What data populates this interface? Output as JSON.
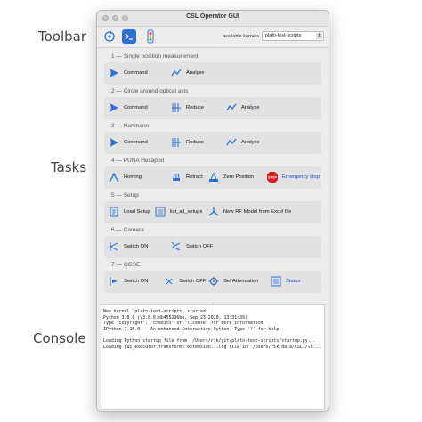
{
  "side_labels": {
    "toolbar": "Toolbar",
    "tasks": "Tasks",
    "console": "Console"
  },
  "window": {
    "title": "CSL Operator GUI"
  },
  "toolbar": {
    "kernel_label": "available kernels",
    "kernel_value": "plato-test-scripts"
  },
  "groups": [
    {
      "title": "1 — Single position measurement",
      "tasks": [
        {
          "label": "Command",
          "icon": "send-icon"
        },
        {
          "label": "Analyse",
          "icon": "analyse-icon"
        }
      ]
    },
    {
      "title": "2 — Circle around optical axis",
      "tasks": [
        {
          "label": "Command",
          "icon": "send-icon"
        },
        {
          "label": "Reduce",
          "icon": "reduce-icon"
        },
        {
          "label": "Analyse",
          "icon": "analyse-icon"
        }
      ]
    },
    {
      "title": "3 — Hartmann",
      "tasks": [
        {
          "label": "Command",
          "icon": "send-icon"
        },
        {
          "label": "Reduce",
          "icon": "reduce-icon"
        },
        {
          "label": "Analyse",
          "icon": "analyse-icon"
        }
      ]
    },
    {
      "title": "4 — PUNA Hexapod",
      "tasks": [
        {
          "label": "Homing",
          "icon": "homing-icon"
        },
        {
          "label": "Retract",
          "icon": "retract-icon"
        },
        {
          "label": "Zero Position",
          "icon": "zero-position-icon"
        },
        {
          "label": "Emergency stop",
          "icon": "stop-icon",
          "stop_text": "STOP"
        }
      ]
    },
    {
      "title": "5 — Setup",
      "tasks": [
        {
          "label": "Load Setup",
          "icon": "load-setup-icon"
        },
        {
          "label": "list_all_setups",
          "icon": "list-icon"
        },
        {
          "label": "New RF Model from Excel file",
          "icon": "model-icon"
        }
      ]
    },
    {
      "title": "6 — Camera",
      "tasks": [
        {
          "label": "Switch ON",
          "icon": "camera-on-icon"
        },
        {
          "label": "Switch OFF",
          "icon": "camera-off-icon"
        }
      ]
    },
    {
      "title": "7 — OGSE",
      "tasks": [
        {
          "label": "Switch ON",
          "icon": "ogse-on-icon"
        },
        {
          "label": "Switch OFF",
          "icon": "ogse-off-icon"
        },
        {
          "label": "Set Attenuation",
          "icon": "attenuation-icon"
        },
        {
          "label": "Status",
          "icon": "status-icon"
        }
      ]
    }
  ],
  "console": {
    "lines": [
      "New kernel 'plato-test-scripts' started...",
      "Python 3.8.6 (v3.8.6:db455296be, Sep 23 2020, 13:31:39)",
      "Type \"copyright\", \"credits\" or \"license\" for more information",
      "IPython 7.15.0 -- An enhanced Interactive Python. Type '?' for help.",
      "",
      "Loading Python startup file from '/Users/rik/git/plato-test-scripts/startup.py...",
      "Loading gui_executor.transforms extension...log file in '/Users/rik/data/CSL1/lo..."
    ]
  },
  "colors": {
    "accent_blue": "#1a49d6",
    "icon_blue": "#2f6fd6",
    "stop_red": "#d42020"
  }
}
